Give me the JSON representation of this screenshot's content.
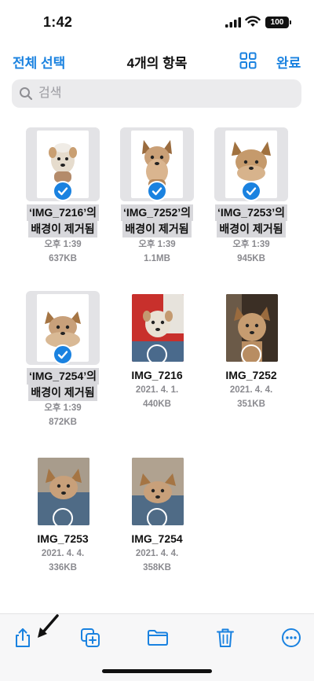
{
  "status_bar": {
    "time": "1:42",
    "battery": "100"
  },
  "nav": {
    "select_all": "전체 선택",
    "title": "4개의 항목",
    "done": "완료",
    "grid_icon": "grid-view-icon"
  },
  "search": {
    "placeholder": "검색",
    "value": ""
  },
  "items": [
    {
      "line1": "‘IMG_7216’의",
      "line2": "배경이 제거됨",
      "meta1": "오후 1:39",
      "meta2": "637KB",
      "selected": true
    },
    {
      "line1": "‘IMG_7252’의",
      "line2": "배경이 제거됨",
      "meta1": "오후 1:39",
      "meta2": "1.1MB",
      "selected": true
    },
    {
      "line1": "‘IMG_7253’의",
      "line2": "배경이 제거됨",
      "meta1": "오후 1:39",
      "meta2": "945KB",
      "selected": true
    },
    {
      "line1": "‘IMG_7254’의",
      "line2": "배경이 제거됨",
      "meta1": "오후 1:39",
      "meta2": "872KB",
      "selected": true
    },
    {
      "line1": "IMG_7216",
      "meta1": "2021. 4. 1.",
      "meta2": "440KB",
      "selected": false
    },
    {
      "line1": "IMG_7252",
      "meta1": "2021. 4. 4.",
      "meta2": "351KB",
      "selected": false
    },
    {
      "line1": "IMG_7253",
      "meta1": "2021. 4. 4.",
      "meta2": "336KB",
      "selected": false
    },
    {
      "line1": "IMG_7254",
      "meta1": "2021. 4. 4.",
      "meta2": "358KB",
      "selected": false
    }
  ],
  "toolbar": {
    "icons": [
      "share-icon",
      "duplicate-icon",
      "move-folder-icon",
      "trash-icon",
      "more-icon"
    ]
  },
  "colors": {
    "accent": "#1a82e0",
    "selected_bg": "#e3e3e6",
    "meta_gray": "#8a8a8f"
  }
}
